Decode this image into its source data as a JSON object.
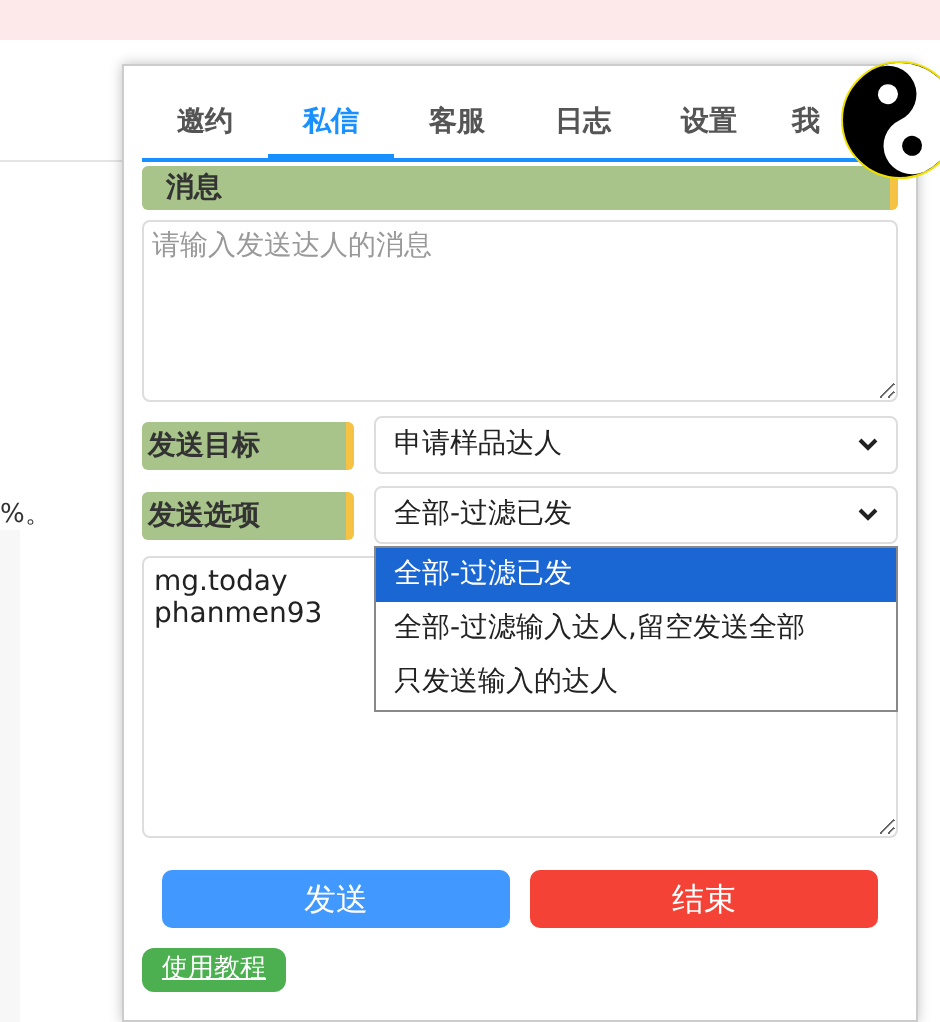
{
  "background": {
    "text_fragment": "%。"
  },
  "tabs": [
    {
      "label": "邀约",
      "selected": false
    },
    {
      "label": "私信",
      "selected": true
    },
    {
      "label": "客服",
      "selected": false
    },
    {
      "label": "日志",
      "selected": false
    },
    {
      "label": "设置",
      "selected": false
    },
    {
      "label": "我",
      "selected": false
    }
  ],
  "message_section": {
    "title": "消息",
    "placeholder": "请输入发送达人的消息"
  },
  "send_target": {
    "label": "发送目标",
    "value": "申请样品达人"
  },
  "send_option": {
    "label": "发送选项",
    "value": "全部-过滤已发",
    "expanded": true,
    "options": [
      {
        "label": "全部-过滤已发",
        "selected": true
      },
      {
        "label": "全部-过滤输入达人,留空发送全部",
        "selected": false
      },
      {
        "label": "只发送输入的达人",
        "selected": false
      }
    ]
  },
  "names_box": {
    "value": "mg.today\nphanmen93"
  },
  "buttons": [
    {
      "label": "发送",
      "kind": "primary"
    },
    {
      "label": "结束",
      "kind": "danger"
    }
  ],
  "tutorial_link": "使用教程"
}
